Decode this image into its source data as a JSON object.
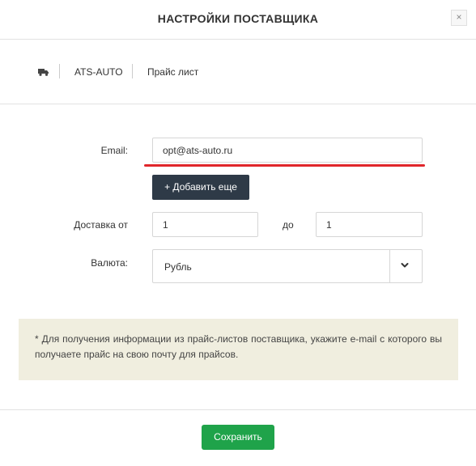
{
  "dialog": {
    "title": "НАСТРОЙКИ ПОСТАВЩИКА",
    "close_label": "×"
  },
  "tabs": [
    {
      "icon": "truck-icon"
    },
    {
      "label": "ATS-AUTO"
    },
    {
      "label": "Прайс лист"
    }
  ],
  "form": {
    "email_label": "Email:",
    "email_value": "opt@ats-auto.ru",
    "add_more_label": "+ Добавить еще",
    "delivery_label": "Доставка от",
    "delivery_from": "1",
    "delivery_to_label": "до",
    "delivery_to": "1",
    "currency_label": "Валюта:",
    "currency_value": "Рубль"
  },
  "note": "* Для получения информации из прайс-листов поставщика, укажите e-mail с которого вы получаете прайс на свою почту для прайсов.",
  "footer": {
    "save_label": "Сохранить"
  },
  "colors": {
    "accent_underline": "#e0262b",
    "save_button": "#1fa34a",
    "add_button": "#2e3a47",
    "note_background": "#f0eedf"
  }
}
